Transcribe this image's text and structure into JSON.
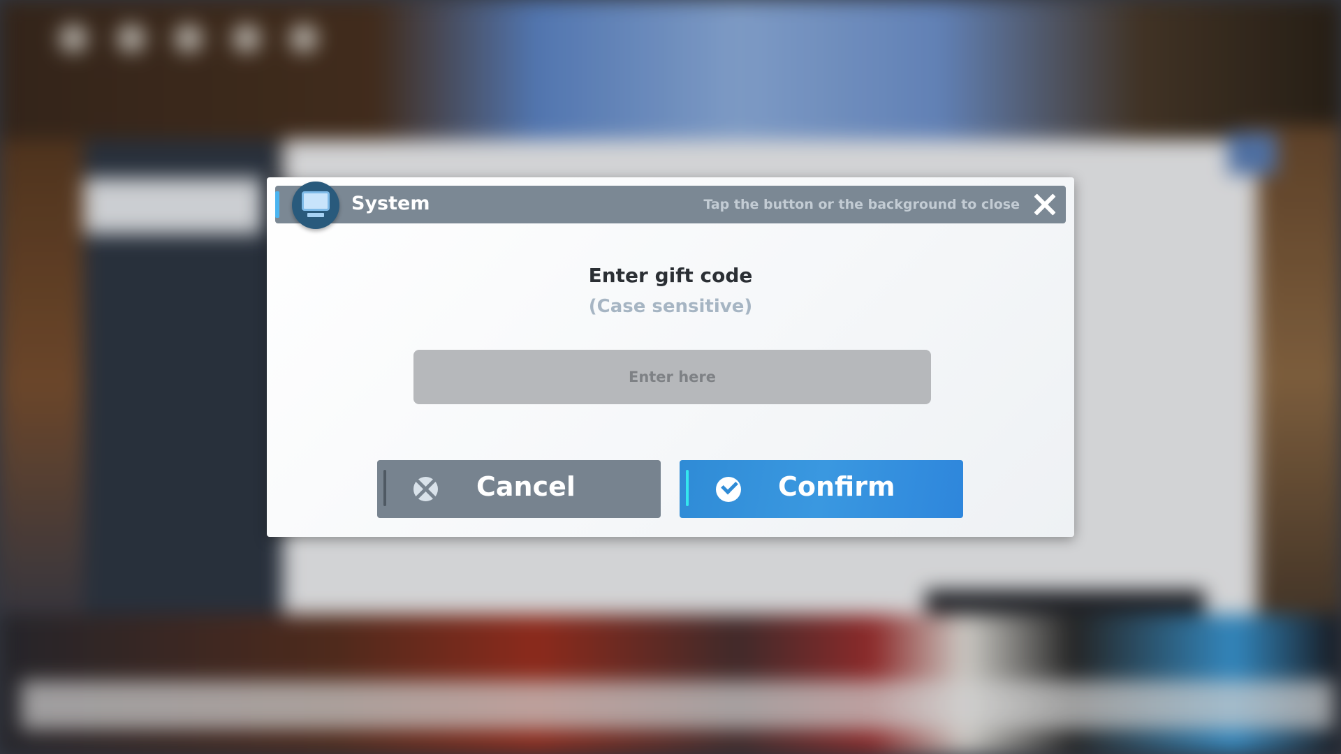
{
  "dialog": {
    "title": "System",
    "icon": "monitor-icon",
    "close_hint": "Tap the button or the background to close",
    "close_icon": "close-icon",
    "heading": "Enter gift code",
    "subheading": "(Case sensitive)",
    "input": {
      "value": "",
      "placeholder": "Enter here"
    },
    "buttons": {
      "cancel": {
        "label": "Cancel",
        "icon": "cancel-circle-icon",
        "color": "#77838f"
      },
      "confirm": {
        "label": "Confirm",
        "icon": "check-circle-icon",
        "color": "#2f8bd6"
      }
    }
  },
  "colors": {
    "titlebar": "#7b8894",
    "accent": "#4ab4f0",
    "input_bg": "#b6b8bb"
  }
}
